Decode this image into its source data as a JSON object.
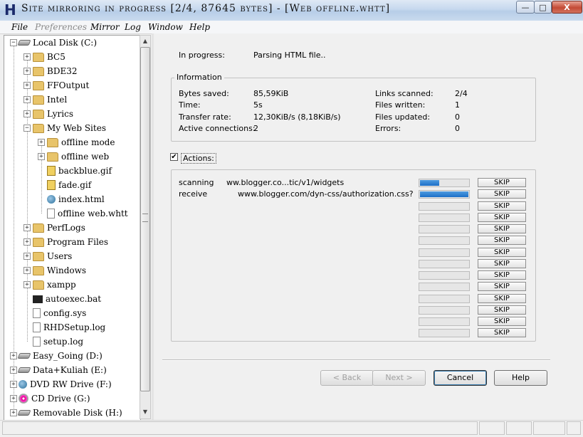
{
  "window": {
    "icon_letter": "H",
    "title": "Site mirroring in progress [2/4, 87645 bytes] - [Web offline.whtt]",
    "min_glyph": "—",
    "max_glyph": "□",
    "close_glyph": "X"
  },
  "menu": [
    "File",
    "Preferences",
    "Mirror",
    "Log",
    "Window",
    "Help"
  ],
  "tree": [
    {
      "label": "Local Disk (C:)",
      "icon": "drive-icon",
      "level": 0,
      "exp": "−"
    },
    {
      "label": "BC5",
      "icon": "folder-icon",
      "level": 1,
      "exp": "+"
    },
    {
      "label": "BDE32",
      "icon": "folder-icon",
      "level": 1,
      "exp": "+"
    },
    {
      "label": "FFOutput",
      "icon": "folder-icon",
      "level": 1,
      "exp": "+"
    },
    {
      "label": "Intel",
      "icon": "folder-icon",
      "level": 1,
      "exp": "+"
    },
    {
      "label": "Lyrics",
      "icon": "folder-icon",
      "level": 1,
      "exp": "+"
    },
    {
      "label": "My Web Sites",
      "icon": "folder-icon",
      "level": 1,
      "exp": "−"
    },
    {
      "label": "offline mode",
      "icon": "folder-icon",
      "level": 2,
      "exp": "+"
    },
    {
      "label": "offline web",
      "icon": "folder-icon",
      "level": 2,
      "exp": "+"
    },
    {
      "label": "backblue.gif",
      "icon": "gif-file-icon",
      "level": 2,
      "exp": ""
    },
    {
      "label": "fade.gif",
      "icon": "gif-file-icon",
      "level": 2,
      "exp": ""
    },
    {
      "label": "index.html",
      "icon": "html-file-icon",
      "level": 2,
      "exp": ""
    },
    {
      "label": "offline web.whtt",
      "icon": "whtt-file-icon",
      "level": 2,
      "exp": ""
    },
    {
      "label": "PerfLogs",
      "icon": "folder-icon",
      "level": 1,
      "exp": "+"
    },
    {
      "label": "Program Files",
      "icon": "folder-icon",
      "level": 1,
      "exp": "+"
    },
    {
      "label": "Users",
      "icon": "folder-icon",
      "level": 1,
      "exp": "+"
    },
    {
      "label": "Windows",
      "icon": "folder-icon",
      "level": 1,
      "exp": "+"
    },
    {
      "label": "xampp",
      "icon": "folder-icon",
      "level": 1,
      "exp": "+"
    },
    {
      "label": "autoexec.bat",
      "icon": "batch-file-icon",
      "level": 1,
      "exp": ""
    },
    {
      "label": "config.sys",
      "icon": "config-file-icon",
      "level": 1,
      "exp": ""
    },
    {
      "label": "RHDSetup.log",
      "icon": "log-file-icon",
      "level": 1,
      "exp": ""
    },
    {
      "label": "setup.log",
      "icon": "log-file-icon",
      "level": 1,
      "exp": ""
    },
    {
      "label": "Easy_Going (D:)",
      "icon": "drive-icon",
      "level": 0,
      "exp": "+"
    },
    {
      "label": "Data+Kuliah (E:)",
      "icon": "drive-icon",
      "level": 0,
      "exp": "+"
    },
    {
      "label": "DVD RW Drive (F:)",
      "icon": "dvd-drive-icon",
      "level": 0,
      "exp": "+"
    },
    {
      "label": "CD Drive (G:)",
      "icon": "cd-drive-icon",
      "level": 0,
      "exp": "+"
    },
    {
      "label": "Removable Disk (H:)",
      "icon": "removable-disk-icon",
      "level": 0,
      "exp": "+"
    }
  ],
  "status": {
    "label": "In progress:",
    "value": "Parsing HTML file.."
  },
  "information": {
    "title": "Information",
    "left": [
      {
        "label": "Bytes saved:",
        "value": "85,59KiB"
      },
      {
        "label": "Time:",
        "value": "5s"
      },
      {
        "label": "Transfer rate:",
        "value": "12,30KiB/s (8,18KiB/s)"
      },
      {
        "label": "Active connections:",
        "value": "2"
      }
    ],
    "right": [
      {
        "label": "Links scanned:",
        "value": "2/4"
      },
      {
        "label": "Files written:",
        "value": "1"
      },
      {
        "label": "Files updated:",
        "value": "0"
      },
      {
        "label": "Errors:",
        "value": "0"
      }
    ]
  },
  "actions": {
    "checkbox_label": "Actions:",
    "checked": true,
    "check_glyph": "✔",
    "skip_label": "SKIP",
    "slots": [
      {
        "action": "scanning",
        "url": "ww.blogger.co...tic/v1/widgets",
        "progress": 0.4
      },
      {
        "action": "receive",
        "url": "www.blogger.com/dyn-css/authorization.css?targetB",
        "progress": 1.0
      },
      {
        "action": "",
        "url": "",
        "progress": 0
      },
      {
        "action": "",
        "url": "",
        "progress": 0
      },
      {
        "action": "",
        "url": "",
        "progress": 0
      },
      {
        "action": "",
        "url": "",
        "progress": 0
      },
      {
        "action": "",
        "url": "",
        "progress": 0
      },
      {
        "action": "",
        "url": "",
        "progress": 0
      },
      {
        "action": "",
        "url": "",
        "progress": 0
      },
      {
        "action": "",
        "url": "",
        "progress": 0
      },
      {
        "action": "",
        "url": "",
        "progress": 0
      },
      {
        "action": "",
        "url": "",
        "progress": 0
      },
      {
        "action": "",
        "url": "",
        "progress": 0
      },
      {
        "action": "",
        "url": "",
        "progress": 0
      }
    ]
  },
  "buttons": {
    "back": "< Back",
    "next": "Next >",
    "cancel": "Cancel",
    "help": "Help"
  },
  "scroll_glyphs": {
    "up": "▲",
    "down": "▼"
  }
}
